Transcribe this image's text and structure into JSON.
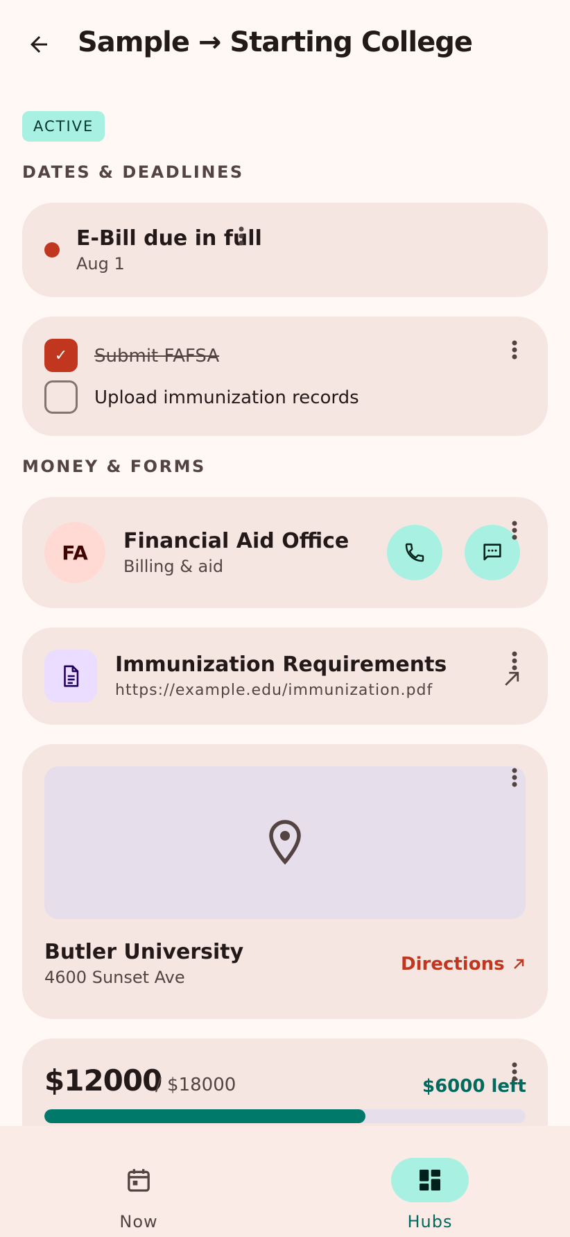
{
  "header": {
    "back_icon": "arrow-back-icon",
    "title": "Sample → Starting College"
  },
  "status": {
    "label": "ACTIVE"
  },
  "sections": {
    "dates": "DATES & DEADLINES",
    "money": "MONEY & FORMS"
  },
  "deadline": {
    "title": "E-Bill due in full",
    "date": "Aug 1",
    "indicator_color": "#c0361f"
  },
  "checklist": {
    "items": [
      {
        "label": "Submit FAFSA",
        "checked": true,
        "check_glyph": "✓"
      },
      {
        "label": "Upload immunization records",
        "checked": false
      }
    ]
  },
  "contact": {
    "initials": "FA",
    "name": "Financial Aid Office",
    "subtitle": "Billing & aid",
    "call_icon": "phone-icon",
    "message_icon": "message-icon"
  },
  "document": {
    "icon": "document-icon",
    "title": "Immunization Requirements",
    "url": "https://example.edu/immunization.pdf",
    "open_icon": "arrow-outward-icon"
  },
  "place": {
    "map_icon": "location-pin-icon",
    "name": "Butler University",
    "address": "4600 Sunset Ave",
    "action_label": "Directions"
  },
  "budget": {
    "amount": "$12000",
    "total": "/ $18000",
    "left": "$6000 left",
    "progress_fraction": 0.6667,
    "fill_color": "#00796b"
  },
  "nav": {
    "items": [
      {
        "label": "Now",
        "icon": "calendar-icon",
        "active": false
      },
      {
        "label": "Hubs",
        "icon": "dashboard-icon",
        "active": true
      }
    ]
  },
  "colors": {
    "accent": "#a8f0e2",
    "danger": "#c0361f",
    "surface": "#f5e6e2",
    "background": "#fff8f5"
  }
}
